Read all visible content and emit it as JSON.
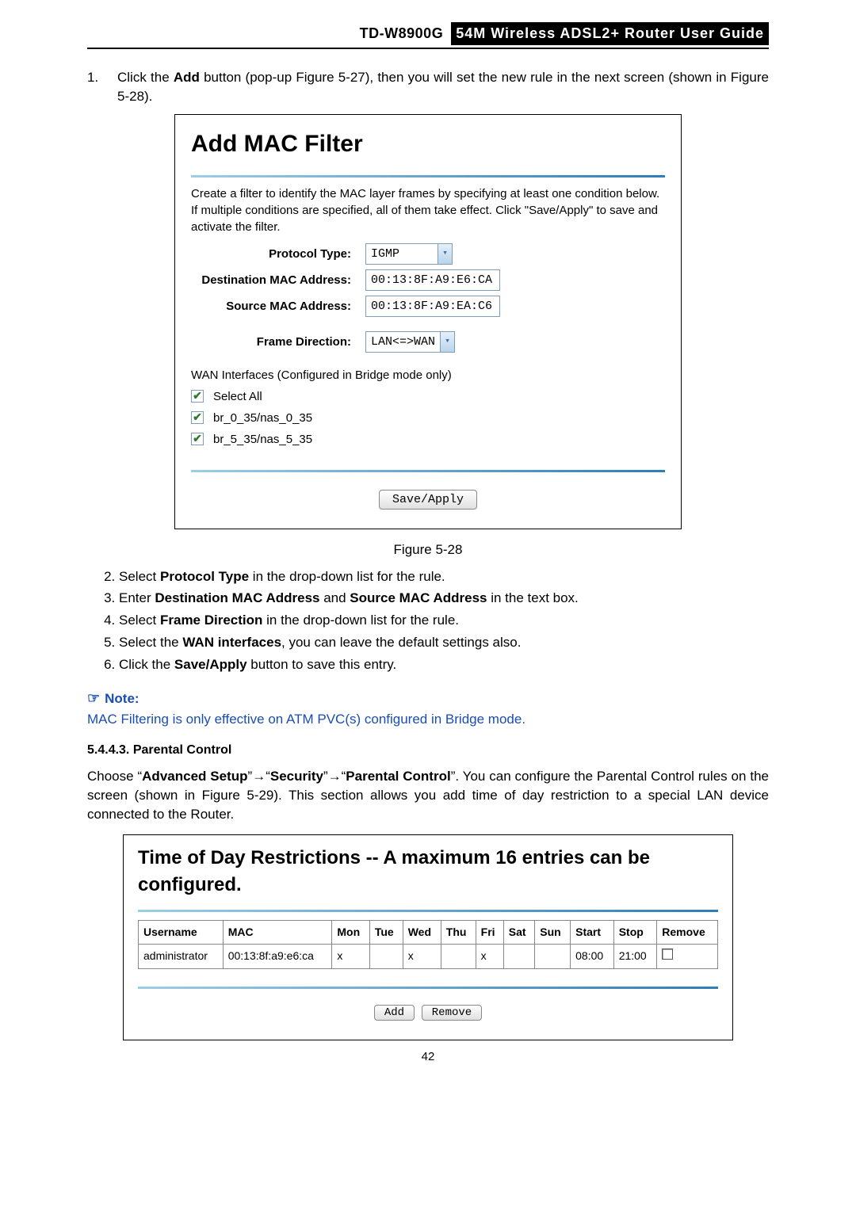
{
  "header": {
    "model": "TD-W8900G",
    "guide": "54M  Wireless  ADSL2+  Router  User  Guide"
  },
  "step1": {
    "num": "1.",
    "pre": "Click the ",
    "b1": "Add",
    "mid": " button (pop-up Figure 5-27), then you will set the new rule in the next screen (shown in Figure 5-28)."
  },
  "fig28": {
    "title": "Add MAC Filter",
    "desc": "Create a filter to identify the MAC layer frames by specifying at least one condition below. If multiple conditions are specified, all of them take effect. Click \"Save/Apply\" to save and activate the filter.",
    "labels": {
      "proto": "Protocol Type:",
      "dest": "Destination MAC Address:",
      "src": "Source MAC Address:",
      "frame": "Frame Direction:"
    },
    "values": {
      "proto": "IGMP",
      "dest": "00:13:8F:A9:E6:CA",
      "src": "00:13:8F:A9:EA:C6",
      "frame": "LAN<=>WAN"
    },
    "wan_head": "WAN Interfaces (Configured in Bridge mode only)",
    "chk": {
      "all": "Select All",
      "i1": "br_0_35/nas_0_35",
      "i2": "br_5_35/nas_5_35"
    },
    "save": "Save/Apply",
    "caption": "Figure 5-28"
  },
  "steps": {
    "s2a": "Select ",
    "s2b": "Protocol Type",
    "s2c": " in the drop-down list for the rule.",
    "s3a": "Enter ",
    "s3b": "Destination MAC Address",
    "s3c": " and ",
    "s3d": "Source MAC Address",
    "s3e": " in the text box.",
    "s4a": "Select ",
    "s4b": "Frame Direction",
    "s4c": " in the drop-down list for the rule.",
    "s5a": "Select the ",
    "s5b": "WAN interfaces",
    "s5c": ", you can leave the default settings also.",
    "s6a": "Click the ",
    "s6b": "Save/Apply",
    "s6c": " button to save this entry."
  },
  "note": {
    "head": "Note:",
    "body": "MAC Filtering is only effective on ATM PVC(s) configured in Bridge mode."
  },
  "section": {
    "num": "5.4.4.3.  Parental Control",
    "p_a": "Choose “",
    "p_b": "Advanced Setup",
    "p_c": "”→“",
    "p_d": "Security",
    "p_e": "”→“",
    "p_f": "Parental Control",
    "p_g": "”. You can configure the Parental Control rules on the screen (shown in Figure 5-29). This section allows you add time of day restriction to a special LAN device connected to the Router."
  },
  "fig29": {
    "title": "Time of Day Restrictions -- A maximum 16 entries can be configured.",
    "headers": [
      "Username",
      "MAC",
      "Mon",
      "Tue",
      "Wed",
      "Thu",
      "Fri",
      "Sat",
      "Sun",
      "Start",
      "Stop",
      "Remove"
    ],
    "row": {
      "user": "administrator",
      "mac": "00:13:8f:a9:e6:ca",
      "mon": "x",
      "tue": "",
      "wed": "x",
      "thu": "",
      "fri": "x",
      "sat": "",
      "sun": "",
      "start": "08:00",
      "stop": "21:00"
    },
    "btn_add": "Add",
    "btn_remove": "Remove"
  },
  "pagenum": "42"
}
